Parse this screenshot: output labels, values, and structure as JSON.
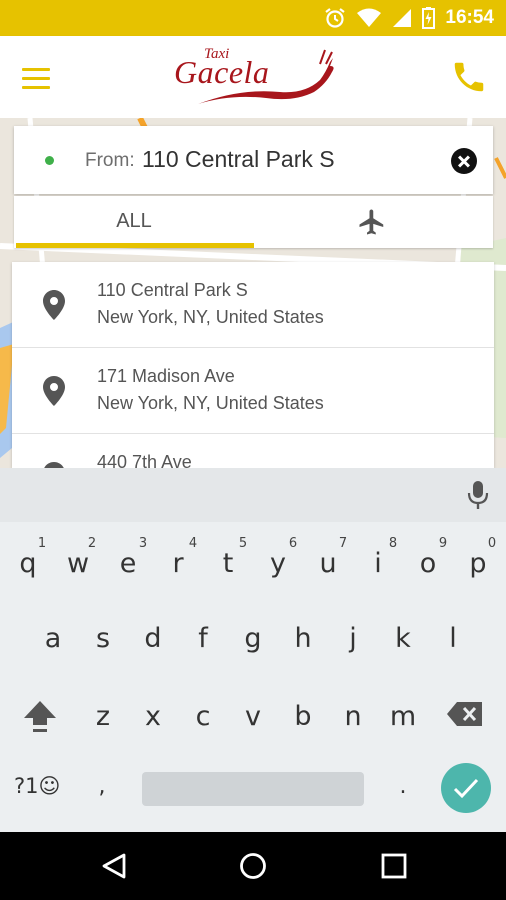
{
  "status_bar": {
    "time": "16:54",
    "icons": [
      "alarm-icon",
      "wifi-icon",
      "signal-icon",
      "battery-charging-icon"
    ]
  },
  "app_bar": {
    "logo_small": "Taxi",
    "logo_main": "Gacela",
    "menu_icon": "menu-icon",
    "call_icon": "phone-icon",
    "accent_color": "#e6c200",
    "brand_color": "#a8161c"
  },
  "search": {
    "label": "From:",
    "value": "110 Central Park S",
    "clear_icon": "clear-icon"
  },
  "tabs": [
    {
      "label": "ALL",
      "selected": true
    },
    {
      "label": "",
      "icon": "airplane-icon",
      "selected": false
    }
  ],
  "suggestions": [
    {
      "line1": "110 Central Park S",
      "line2": "New York, NY, United States",
      "icon": "location-pin-icon"
    },
    {
      "line1": "171 Madison Ave",
      "line2": "New York, NY, United States",
      "icon": "location-pin-icon"
    },
    {
      "line1": "440 7th Ave",
      "line2": "",
      "icon": "location-pin-icon"
    }
  ],
  "keyboard": {
    "row1": [
      "q",
      "w",
      "e",
      "r",
      "t",
      "y",
      "u",
      "i",
      "o",
      "p"
    ],
    "row1_hints": [
      "1",
      "2",
      "3",
      "4",
      "5",
      "6",
      "7",
      "8",
      "9",
      "0"
    ],
    "row2": [
      "a",
      "s",
      "d",
      "f",
      "g",
      "h",
      "j",
      "k",
      "l"
    ],
    "row3": [
      "z",
      "x",
      "c",
      "v",
      "b",
      "n",
      "m"
    ],
    "symbols_label": "?1☺",
    "comma": ",",
    "period": ".",
    "enter_color": "#4db6ac"
  },
  "nav_bar": {
    "icons": [
      "back-icon",
      "home-icon",
      "recents-icon"
    ]
  }
}
